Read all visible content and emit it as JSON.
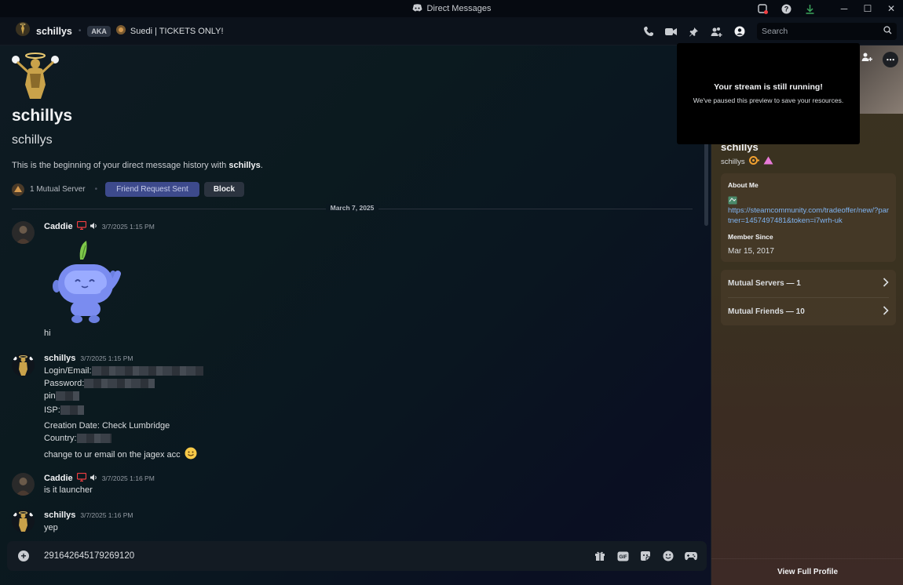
{
  "window": {
    "title": "Direct Messages"
  },
  "header": {
    "username": "schillys",
    "aka_badge": "AKA",
    "aka_name": "Suedi | TICKETS ONLY!",
    "search_placeholder": "Search"
  },
  "intro": {
    "display_name": "schillys",
    "username": "schillys",
    "text_prefix": "This is the beginning of your direct message history with ",
    "text_name": "schillys",
    "text_suffix": ".",
    "mutual_servers": "1 Mutual Server",
    "friend_request": "Friend Request Sent",
    "block": "Block"
  },
  "date_divider": "March 7, 2025",
  "messages": [
    {
      "author": "Caddie",
      "timestamp": "3/7/2025 1:15 PM",
      "lines": [
        "hi"
      ]
    },
    {
      "author": "schillys",
      "timestamp": "3/7/2025 1:15 PM",
      "lines": [
        "Login/Email:",
        "Password:",
        "pin",
        "ISP:",
        "Creation Date: Check Lumbridge",
        "Country:",
        "change to ur email on the jagex acc"
      ]
    },
    {
      "author": "Caddie",
      "timestamp": "3/7/2025 1:16 PM",
      "lines": [
        "is it launcher"
      ]
    },
    {
      "author": "schillys",
      "timestamp": "3/7/2025 1:16 PM",
      "lines": [
        "yep"
      ]
    }
  ],
  "composer": {
    "value": "291642645179269120"
  },
  "stream": {
    "title": "Your stream is still running!",
    "subtitle": "We've paused this preview to save your resources."
  },
  "profile": {
    "name": "schillys",
    "username": "schillys",
    "about_heading": "About Me",
    "about_link": "https://steamcommunity.com/tradeoffer/new/?partner=1457497481&token=i7wrh-uk",
    "member_since_heading": "Member Since",
    "member_since": "Mar 15, 2017",
    "mutual_servers": "Mutual Servers — 1",
    "mutual_friends": "Mutual Friends — 10",
    "view_full": "View Full Profile"
  },
  "colors": {
    "accent_red": "#f23f42",
    "link": "#7fb4f2",
    "friend_button": "#3d4a8c"
  }
}
